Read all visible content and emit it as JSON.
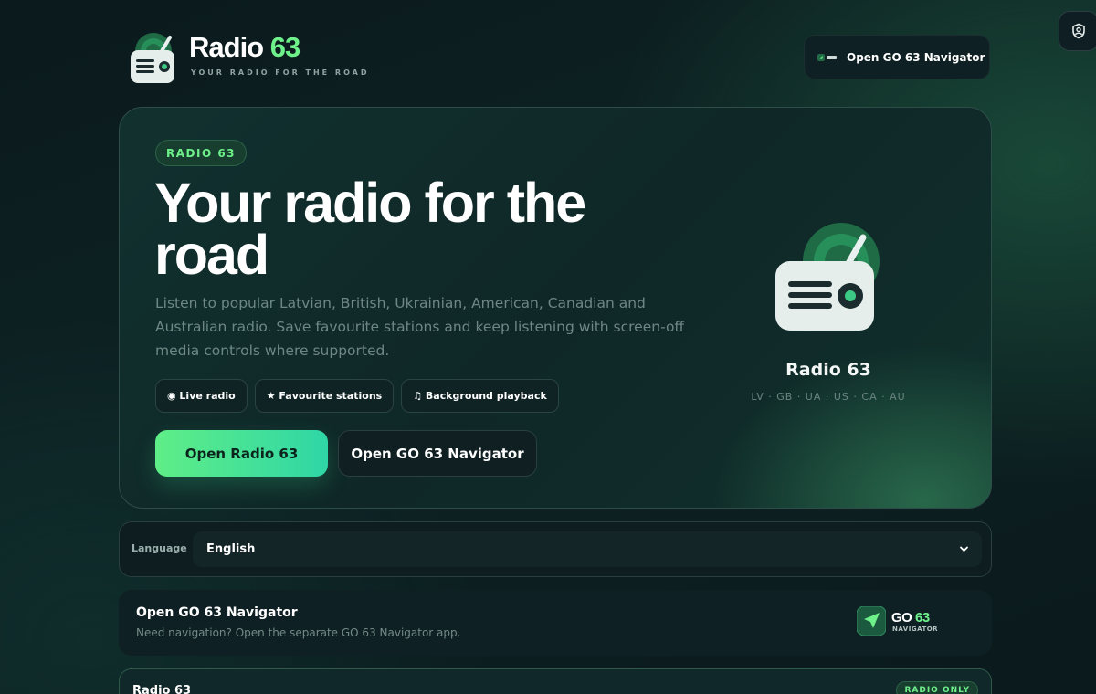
{
  "header": {
    "brand_name": "Radio",
    "brand_number": "63",
    "tagline": "YOUR RADIO FOR THE ROAD",
    "navigator_button": "Open GO 63 Navigator"
  },
  "hero": {
    "badge": "RADIO 63",
    "title": "Your radio for the road",
    "description": "Listen to popular Latvian, British, Ukrainian, American, Canadian and Australian radio. Save favourite stations and keep listening with screen-off media controls where supported.",
    "chips": [
      "◉ Live radio",
      "★ Favourite stations",
      "♫ Background playback"
    ],
    "primary_button": "Open Radio 63",
    "secondary_button": "Open GO 63 Navigator",
    "app_name": "Radio 63",
    "regions": "LV · GB · UA · US · CA · AU"
  },
  "language": {
    "label": "Language",
    "selected": "English"
  },
  "navigator_card": {
    "title": "Open GO 63 Navigator",
    "subtitle": "Need navigation? Open the separate GO 63 Navigator app.",
    "logo_word": "GO",
    "logo_number": "63",
    "logo_sub": "NAVIGATOR"
  },
  "radio_card": {
    "title": "Radio 63",
    "badge": "RADIO ONLY"
  },
  "colors": {
    "accent": "#6ef08a",
    "accent_teal": "#2fd6a6",
    "background": "#0d2224"
  },
  "icons": {
    "brand_logo": "radio-icon",
    "corner": "shield-user-icon",
    "select": "chevron-down-icon",
    "navigator": "navigation-arrow-icon"
  }
}
